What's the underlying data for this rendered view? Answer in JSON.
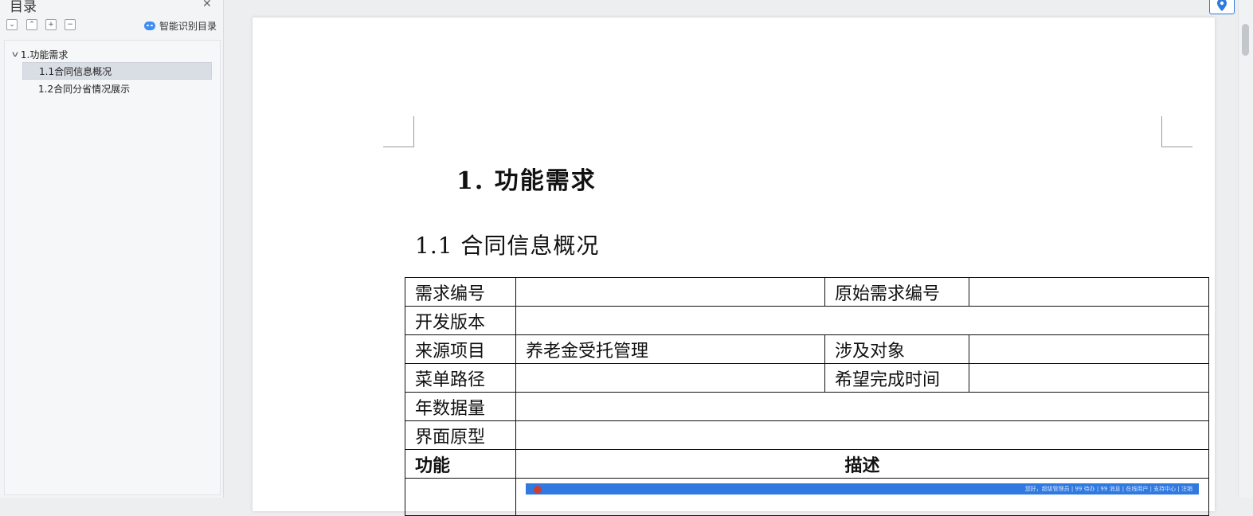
{
  "sidebar": {
    "title": "目录",
    "close_icon": "close-icon",
    "toolbar": {
      "expand_label": "⌄",
      "collapse_label": "⌃",
      "expand_all_label": "+",
      "collapse_all_label": "−",
      "smart_toc_label": "智能识别目录"
    },
    "tree": [
      {
        "label": "1.功能需求",
        "level": 1,
        "expanded": true
      },
      {
        "label": "1.1合同信息概况",
        "level": 2,
        "selected": true
      },
      {
        "label": "1.2合同分省情况展示",
        "level": 2,
        "selected": false
      }
    ]
  },
  "document": {
    "heading1": "1. 功能需求",
    "heading2": "1.1 合同信息概况",
    "table": {
      "r1": {
        "a": "需求编号",
        "b": "",
        "c": "原始需求编号",
        "d": ""
      },
      "r2": {
        "a": "开发版本",
        "b": ""
      },
      "r3": {
        "a": "来源项目",
        "b": "养老金受托管理",
        "c": "涉及对象",
        "d": ""
      },
      "r4": {
        "a": "菜单路径",
        "b": "",
        "c": "希望完成时间",
        "d": ""
      },
      "r5": {
        "a": "年数据量",
        "b": ""
      },
      "r6": {
        "a": "界面原型",
        "b": ""
      },
      "header": {
        "a": "功能",
        "b": "描述"
      }
    },
    "prototype_bar": {
      "nav_text": "您好，超级管理员 | 99 待办 | 99 消息 | 在线用户 | 支持中心 | 注销"
    }
  },
  "colors": {
    "accent": "#2f79e0",
    "selected_row": "#d9dde4",
    "sidebar_bg": "#f3f4f6"
  }
}
